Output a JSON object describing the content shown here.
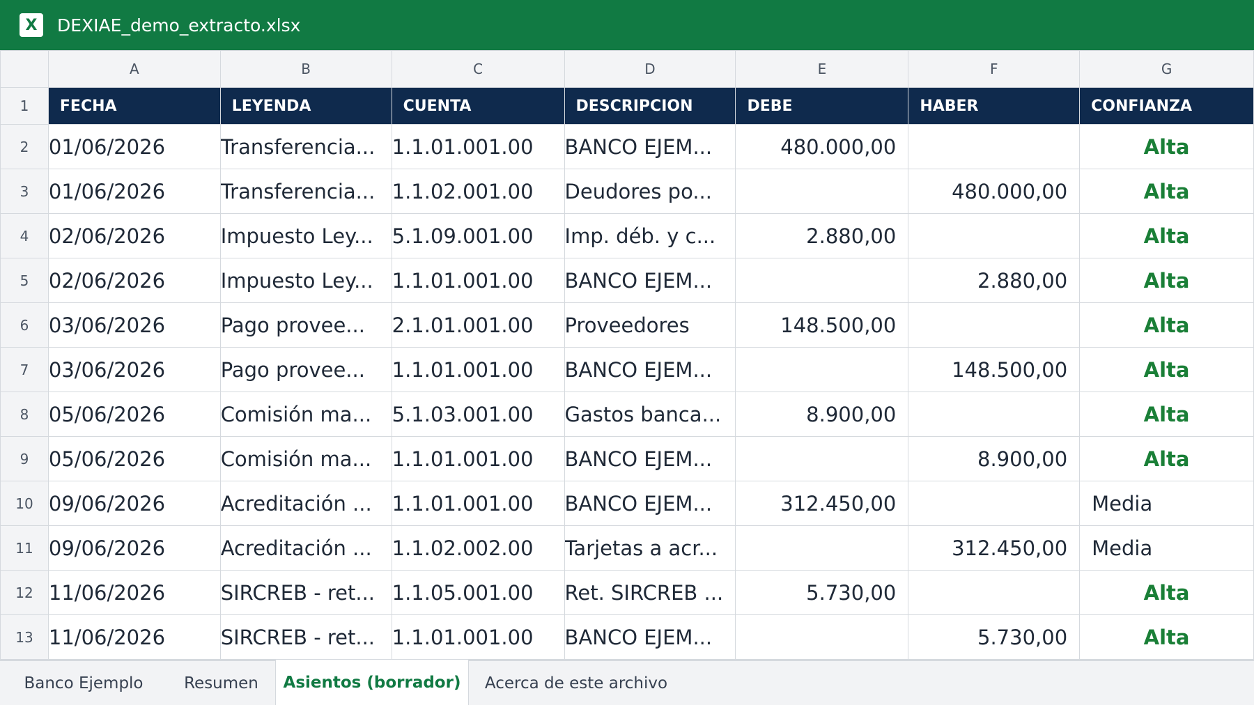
{
  "window": {
    "title": "DEXIAE_demo_extracto.xlsx",
    "icon": "excel-icon",
    "icon_letter": "X"
  },
  "colors": {
    "brand": "#117a43",
    "header_bg": "#0f2a4d",
    "alta": "#1a7f37"
  },
  "columns": [
    "A",
    "B",
    "C",
    "D",
    "E",
    "F",
    "G"
  ],
  "headers": [
    "FECHA",
    "LEYENDA",
    "CUENTA",
    "DESCRIPCION",
    "DEBE",
    "HABER",
    "CONFIANZA"
  ],
  "rows": [
    {
      "n": "1"
    },
    {
      "n": "2",
      "fecha": "01/06/2026",
      "leyenda": "Transferencia...",
      "cuenta": "1.1.01.001.00",
      "descripcion": "BANCO EJEM...",
      "debe": "480.000,00",
      "haber": "",
      "confianza": "Alta"
    },
    {
      "n": "3",
      "fecha": "01/06/2026",
      "leyenda": "Transferencia...",
      "cuenta": "1.1.02.001.00",
      "descripcion": "Deudores po...",
      "debe": "",
      "haber": "480.000,00",
      "confianza": "Alta"
    },
    {
      "n": "4",
      "fecha": "02/06/2026",
      "leyenda": "Impuesto Ley...",
      "cuenta": "5.1.09.001.00",
      "descripcion": "Imp. déb. y c...",
      "debe": "2.880,00",
      "haber": "",
      "confianza": "Alta"
    },
    {
      "n": "5",
      "fecha": "02/06/2026",
      "leyenda": "Impuesto Ley...",
      "cuenta": "1.1.01.001.00",
      "descripcion": "BANCO EJEM...",
      "debe": "",
      "haber": "2.880,00",
      "confianza": "Alta"
    },
    {
      "n": "6",
      "fecha": "03/06/2026",
      "leyenda": "Pago provee...",
      "cuenta": "2.1.01.001.00",
      "descripcion": "Proveedores",
      "debe": "148.500,00",
      "haber": "",
      "confianza": "Alta"
    },
    {
      "n": "7",
      "fecha": "03/06/2026",
      "leyenda": "Pago provee...",
      "cuenta": "1.1.01.001.00",
      "descripcion": "BANCO EJEM...",
      "debe": "",
      "haber": "148.500,00",
      "confianza": "Alta"
    },
    {
      "n": "8",
      "fecha": "05/06/2026",
      "leyenda": "Comisión ma...",
      "cuenta": "5.1.03.001.00",
      "descripcion": "Gastos banca...",
      "debe": "8.900,00",
      "haber": "",
      "confianza": "Alta"
    },
    {
      "n": "9",
      "fecha": "05/06/2026",
      "leyenda": "Comisión ma...",
      "cuenta": "1.1.01.001.00",
      "descripcion": "BANCO EJEM...",
      "debe": "",
      "haber": "8.900,00",
      "confianza": "Alta"
    },
    {
      "n": "10",
      "fecha": "09/06/2026",
      "leyenda": "Acreditación ...",
      "cuenta": "1.1.01.001.00",
      "descripcion": "BANCO EJEM...",
      "debe": "312.450,00",
      "haber": "",
      "confianza": "Media"
    },
    {
      "n": "11",
      "fecha": "09/06/2026",
      "leyenda": "Acreditación ...",
      "cuenta": "1.1.02.002.00",
      "descripcion": "Tarjetas a acr...",
      "debe": "",
      "haber": "312.450,00",
      "confianza": "Media"
    },
    {
      "n": "12",
      "fecha": "11/06/2026",
      "leyenda": "SIRCREB - ret...",
      "cuenta": "1.1.05.001.00",
      "descripcion": "Ret. SIRCREB ...",
      "debe": "5.730,00",
      "haber": "",
      "confianza": "Alta"
    },
    {
      "n": "13",
      "fecha": "11/06/2026",
      "leyenda": "SIRCREB - ret...",
      "cuenta": "1.1.01.001.00",
      "descripcion": "BANCO EJEM...",
      "debe": "",
      "haber": "5.730,00",
      "confianza": "Alta"
    }
  ],
  "tabs": [
    {
      "label": "Banco Ejemplo",
      "active": false
    },
    {
      "label": "Resumen",
      "active": false
    },
    {
      "label": "Asientos (borrador)",
      "active": true
    },
    {
      "label": "Acerca de este archivo",
      "active": false
    }
  ]
}
